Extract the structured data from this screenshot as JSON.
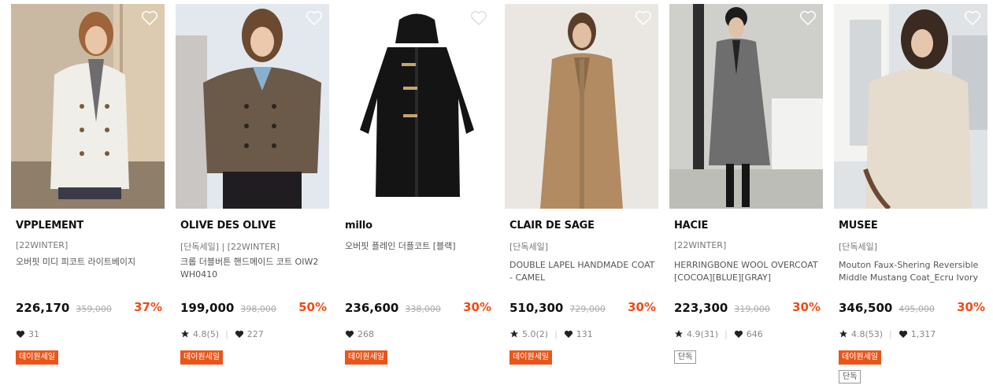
{
  "products": [
    {
      "brand": "VPPLEMENT",
      "tag": "[22WINTER]",
      "name": "오버핏 미디 피코트 라이트베이지",
      "price": "226,170",
      "original_price": "359,000",
      "discount": "37%",
      "rating": "",
      "likes": "31",
      "badges": [
        "데이원세일"
      ],
      "icon": "heart-outline-icon"
    },
    {
      "brand": "OLIVE DES OLIVE",
      "tag": "[단독세일] | [22WINTER]",
      "name": "크롭 더블버튼 핸드메이드 코트 OIW2WH0410",
      "price": "199,000",
      "original_price": "398,000",
      "discount": "50%",
      "rating": "4.8(5)",
      "likes": "227",
      "badges": [
        "데이원세일"
      ],
      "icon": "heart-outline-icon"
    },
    {
      "brand": "millo",
      "tag": "",
      "name": "오버핏 플레인 더플코트 [블랙]",
      "price": "236,600",
      "original_price": "338,000",
      "discount": "30%",
      "rating": "",
      "likes": "268",
      "badges": [
        "데이원세일"
      ],
      "icon": "heart-outline-icon"
    },
    {
      "brand": "CLAIR DE SAGE",
      "tag": "[단독세일]",
      "name": "DOUBLE LAPEL HANDMADE COAT - CAMEL",
      "price": "510,300",
      "original_price": "729,000",
      "discount": "30%",
      "rating": "5.0(2)",
      "likes": "131",
      "badges": [
        "데이원세일"
      ],
      "icon": "heart-outline-icon"
    },
    {
      "brand": "HACIE",
      "tag": "[22WINTER]",
      "name": "HERRINGBONE WOOL OVERCOAT [COCOA][BLUE][GRAY]",
      "price": "223,300",
      "original_price": "319,000",
      "discount": "30%",
      "rating": "4.9(31)",
      "likes": "646",
      "badges": [
        "단독"
      ],
      "icon": "heart-outline-icon"
    },
    {
      "brand": "MUSEE",
      "tag": "[단독세일]",
      "name": "Mouton Faux-Shering Reversible Middle Mustang Coat_Ecru Ivory",
      "price": "346,500",
      "original_price": "495,000",
      "discount": "30%",
      "rating": "4.8(53)",
      "likes": "1,317",
      "badges": [
        "데이원세일",
        "단독"
      ],
      "icon": "heart-outline-icon"
    }
  ],
  "colors": {
    "discount": "#f04c16",
    "sale_badge_bg": "#e8561b",
    "price": "#111111",
    "original_price": "#aaaaaa"
  }
}
